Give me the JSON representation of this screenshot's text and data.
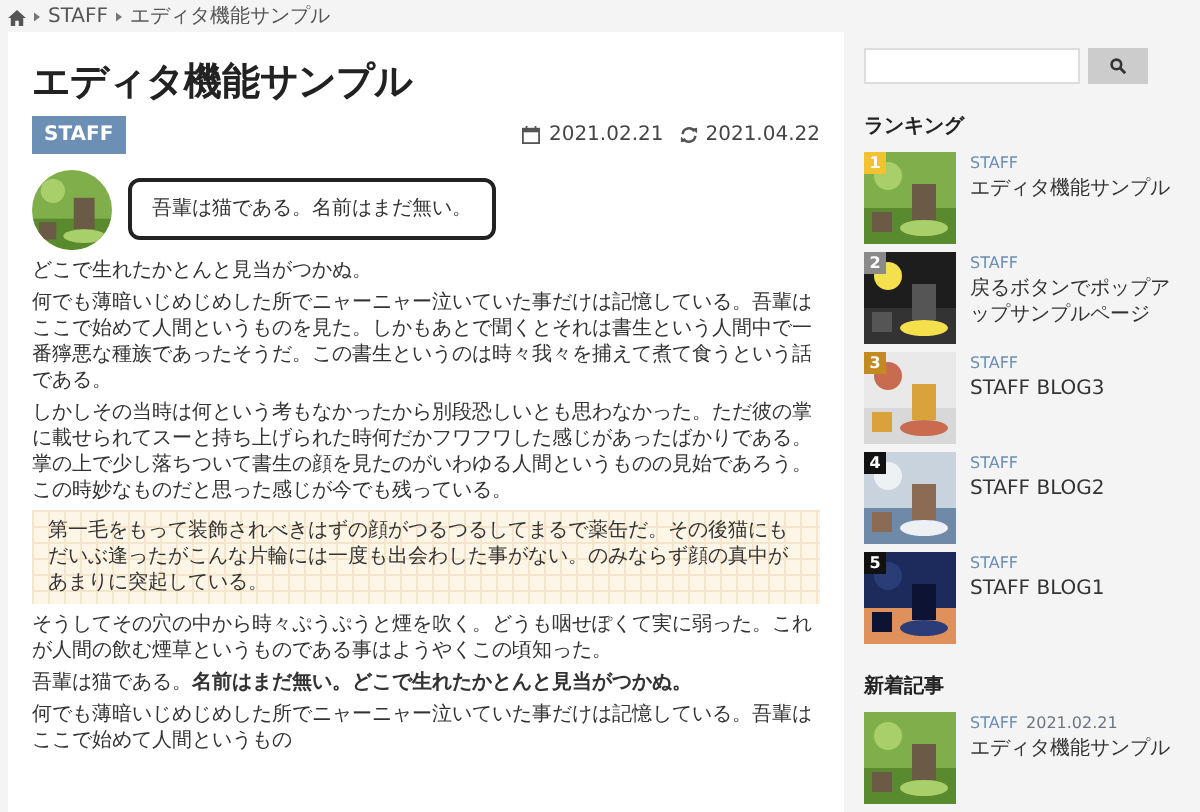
{
  "breadcrumb": [
    "STAFF",
    "エディタ機能サンプル"
  ],
  "article": {
    "title": "エディタ機能サンプル",
    "category": "STAFF",
    "published": "2021.02.21",
    "updated": "2021.04.22",
    "speech": "吾輩は猫である。名前はまだ無い。",
    "blocks": [
      {
        "kind": "paragraph",
        "text": "どこで生れたかとんと見当がつかぬ。"
      },
      {
        "kind": "paragraph",
        "text": "何でも薄暗いじめじめした所でニャーニャー泣いていた事だけは記憶している。吾輩はここで始めて人間というものを見た。しかもあとで聞くとそれは書生という人間中で一番獰悪な種族であったそうだ。この書生というのは時々我々を捕えて煮て食うという話である。"
      },
      {
        "kind": "paragraph",
        "text": "しかしその当時は何という考もなかったから別段恐しいとも思わなかった。ただ彼の掌に載せられてスーと持ち上げられた時何だかフワフワした感じがあったばかりである。掌の上で少し落ちついて書生の顔を見たのがいわゆる人間というものの見始であろう。この時妙なものだと思った感じが今でも残っている。"
      },
      {
        "kind": "note",
        "text": "第一毛をもって装飾されべきはずの顔がつるつるしてまるで薬缶だ。その後猫にもだいぶ逢ったがこんな片輪には一度も出会わした事がない。のみならず顔の真中があまりに突起している。"
      },
      {
        "kind": "paragraph",
        "text": "そうしてその穴の中から時々ぷうぷうと煙を吹く。どうも咽せぽくて実に弱った。これが人間の飲む煙草というものである事はようやくこの頃知った。"
      },
      {
        "kind": "paragraph",
        "text": "吾輩は猫である。**名前はまだ無い。どこで生れたかとんと見当がつかぬ。**"
      },
      {
        "kind": "paragraph",
        "text": "何でも薄暗いじめじめした所でニャーニャー泣いていた事だけは記憶している。吾輩はここで始めて人間というもの"
      }
    ]
  },
  "sidebar": {
    "ranking_title": "ランキング",
    "ranking": [
      {
        "rank": "1",
        "color": "#f2c230",
        "category": "STAFF",
        "title": "エディタ機能サンプル"
      },
      {
        "rank": "2",
        "color": "#8a8a8a",
        "category": "STAFF",
        "title": "戻るボタンでポップアップサンプルページ"
      },
      {
        "rank": "3",
        "color": "#c48a22",
        "category": "STAFF",
        "title": "STAFF BLOG3"
      },
      {
        "rank": "4",
        "color": "#111111",
        "category": "STAFF",
        "title": "STAFF BLOG2"
      },
      {
        "rank": "5",
        "color": "#111111",
        "category": "STAFF",
        "title": "STAFF BLOG1"
      }
    ],
    "recent_title": "新着記事",
    "recent": [
      {
        "category": "STAFF",
        "date": "2021.02.21",
        "title": "エディタ機能サンプル"
      }
    ]
  }
}
